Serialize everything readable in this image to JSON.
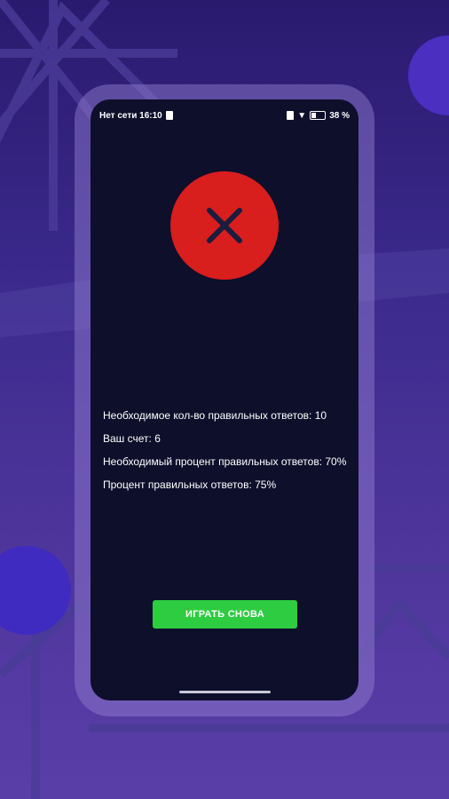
{
  "status_bar": {
    "carrier_time": "Нет сети 16:10",
    "battery": "38 %"
  },
  "result": {
    "icon": "close-icon",
    "required_correct": "Необходимое кол-во правильных ответов: 10",
    "score": "Ваш счет: 6",
    "required_percent": "Необходимый процент правильных ответов: 70%",
    "correct_percent": "Процент правильных ответов: 75%"
  },
  "actions": {
    "play_again_label": "ИГРАТЬ СНОВА"
  },
  "colors": {
    "accent_fail": "#d91e1e",
    "button_green": "#2ecc40",
    "screen_bg": "#0d0f2b"
  }
}
